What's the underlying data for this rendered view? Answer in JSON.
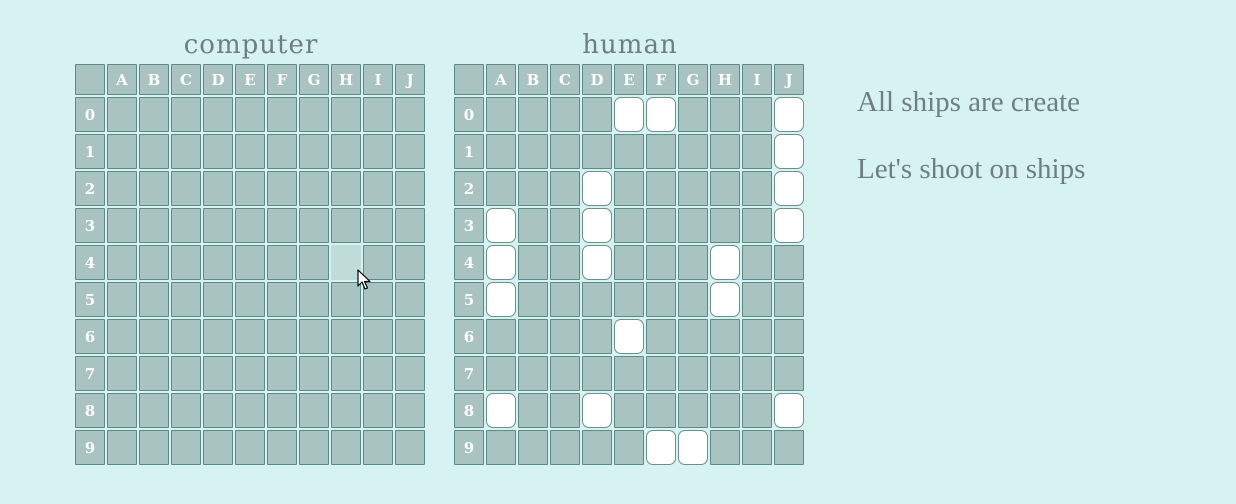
{
  "columns": [
    "A",
    "B",
    "C",
    "D",
    "E",
    "F",
    "G",
    "H",
    "I",
    "J"
  ],
  "rows": [
    "0",
    "1",
    "2",
    "3",
    "4",
    "5",
    "6",
    "7",
    "8",
    "9"
  ],
  "boards": {
    "computer": {
      "title": "computer",
      "ships": [],
      "hovered_cell": "H4"
    },
    "human": {
      "title": "human",
      "ships": [
        "E0",
        "F0",
        "J0",
        "J1",
        "D2",
        "J2",
        "A3",
        "D3",
        "J3",
        "A4",
        "D4",
        "H4",
        "A5",
        "H5",
        "E6",
        "A8",
        "D8",
        "J8",
        "F9",
        "G9"
      ]
    }
  },
  "messages": {
    "status": "All ships are create",
    "prompt": "Let's shoot on ships"
  },
  "colors": {
    "background": "#d6f3f1",
    "cell": "#a9c3c0",
    "ship": "#ffffff",
    "hover": "#c0dcd8",
    "text": "#6f7f7d"
  }
}
